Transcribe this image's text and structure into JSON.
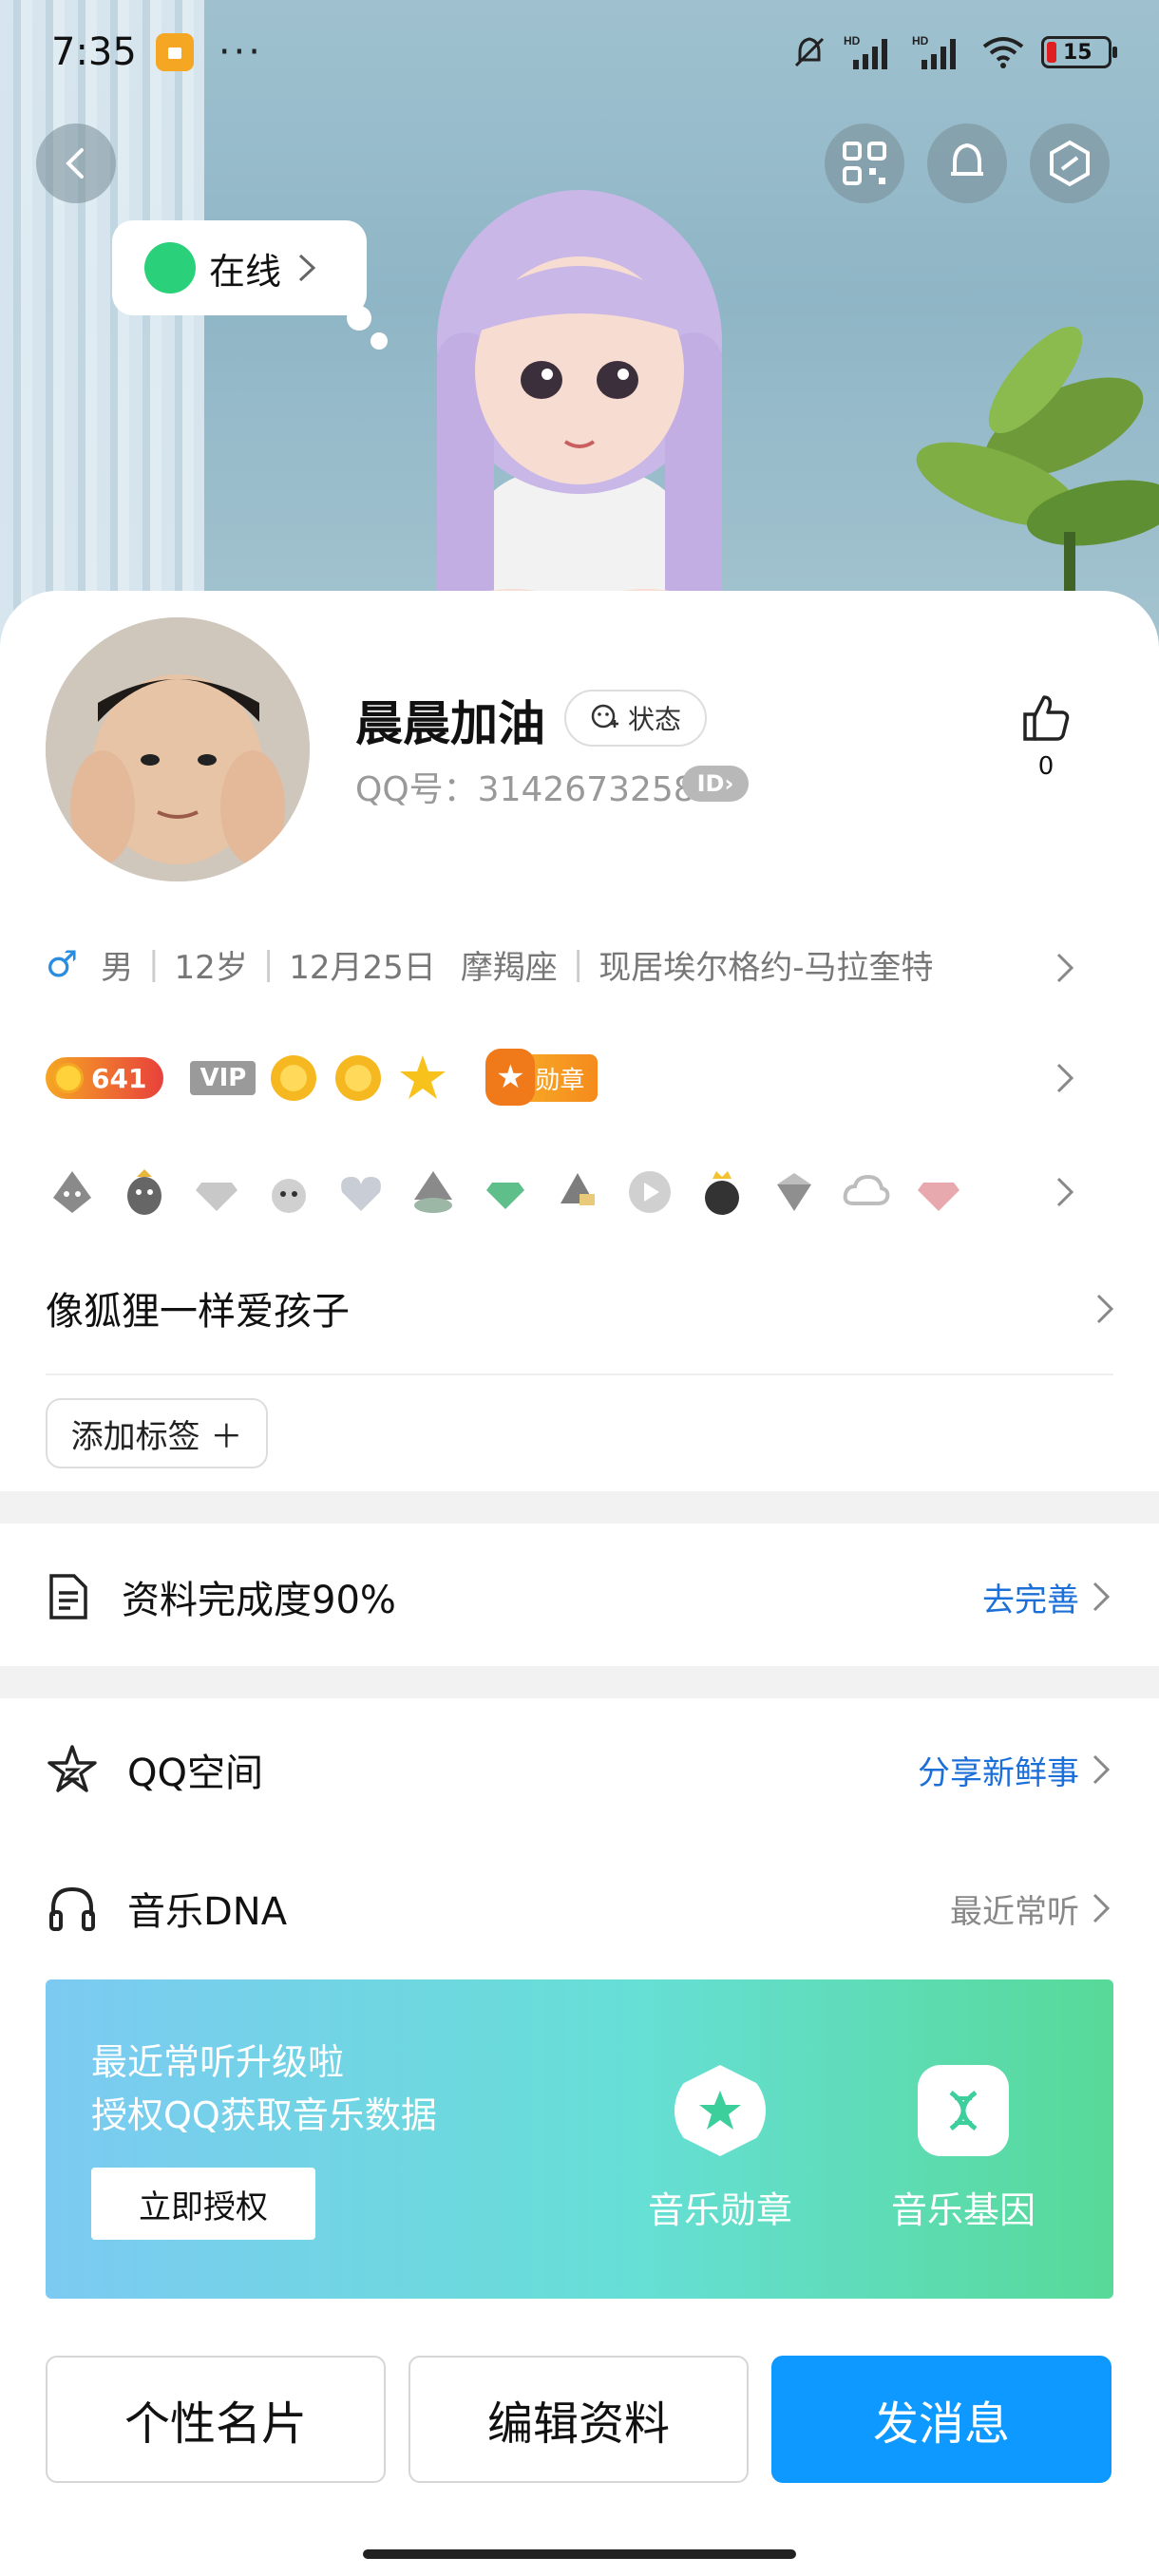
{
  "status_bar": {
    "time": "7:35",
    "dots": "···",
    "battery": "15",
    "hd1": "HD",
    "hd2": "HD"
  },
  "hero": {
    "online_status": "在线"
  },
  "profile": {
    "name": "晨晨加油",
    "status_chip": "状态",
    "qq_number": "QQ号：3142673258",
    "id_chip": "ID",
    "like_count": "0"
  },
  "info": {
    "gender_symbol": "♂",
    "gender": "男",
    "age": "12岁",
    "birthday": "12月25日",
    "zodiac": "摩羯座",
    "location": "现居埃尔格约-马拉奎特"
  },
  "badges": {
    "level": "641",
    "vip": "VIP",
    "medal": "勋章"
  },
  "bio": "像狐狸一样爱孩子",
  "add_tag": "添加标签 ＋",
  "profile_completion": {
    "label": "资料完成度90%",
    "action": "去完善"
  },
  "qzone": {
    "label": "QQ空间",
    "action": "分享新鲜事"
  },
  "music_dna": {
    "label": "音乐DNA",
    "action": "最近常听"
  },
  "music_card": {
    "line1": "最近常听升级啦",
    "line2": "授权QQ获取音乐数据",
    "button": "立即授权",
    "feature1": "音乐勋章",
    "feature2": "音乐基因"
  },
  "bottom_buttons": {
    "card": "个性名片",
    "edit": "编辑资料",
    "message": "发消息"
  },
  "colors": {
    "primary_blue": "#0D99FF",
    "link_blue": "#1B6FD8",
    "online_green": "#2BD17A"
  }
}
